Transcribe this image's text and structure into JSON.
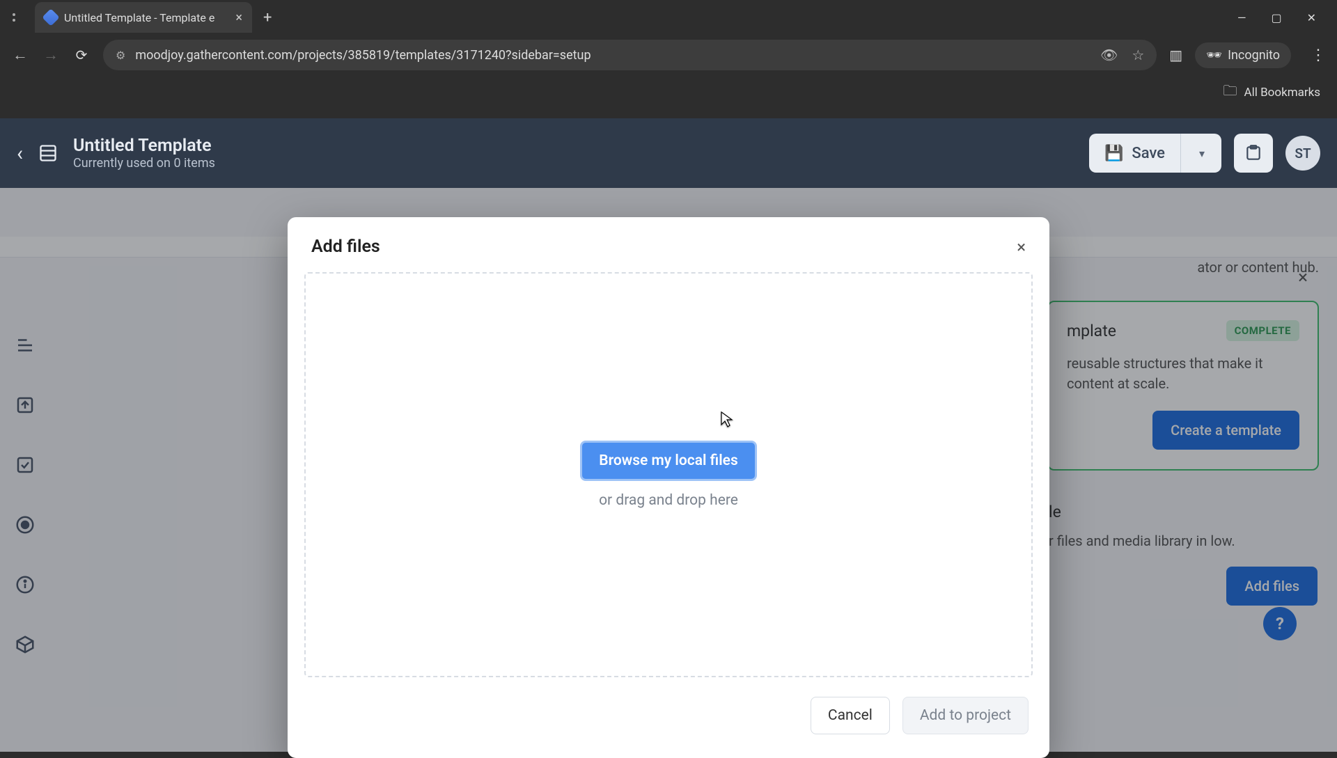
{
  "browser": {
    "tab_title": "Untitled Template - Template e",
    "url": "moodjoy.gathercontent.com/projects/385819/templates/3171240?sidebar=setup",
    "incognito_label": "Incognito",
    "bookmarks_label": "All Bookmarks"
  },
  "header": {
    "title": "Untitled Template",
    "subtitle": "Currently used on 0 items",
    "save_label": "Save",
    "avatar_initials": "ST"
  },
  "panel": {
    "snippet_suffix": "ator or content hub.",
    "card1_title_suffix": "mplate",
    "card1_badge": "COMPLETE",
    "card1_text": "reusable structures that make it content at scale.",
    "card1_button": "Create a template",
    "card2_title_suffix": "le",
    "card2_text": "r files and media library in low.",
    "card2_button": "Add files"
  },
  "modal": {
    "title": "Add files",
    "browse_label": "Browse my local files",
    "drag_hint": "or drag and drop here",
    "cancel_label": "Cancel",
    "confirm_label": "Add to project"
  },
  "help_label": "?"
}
